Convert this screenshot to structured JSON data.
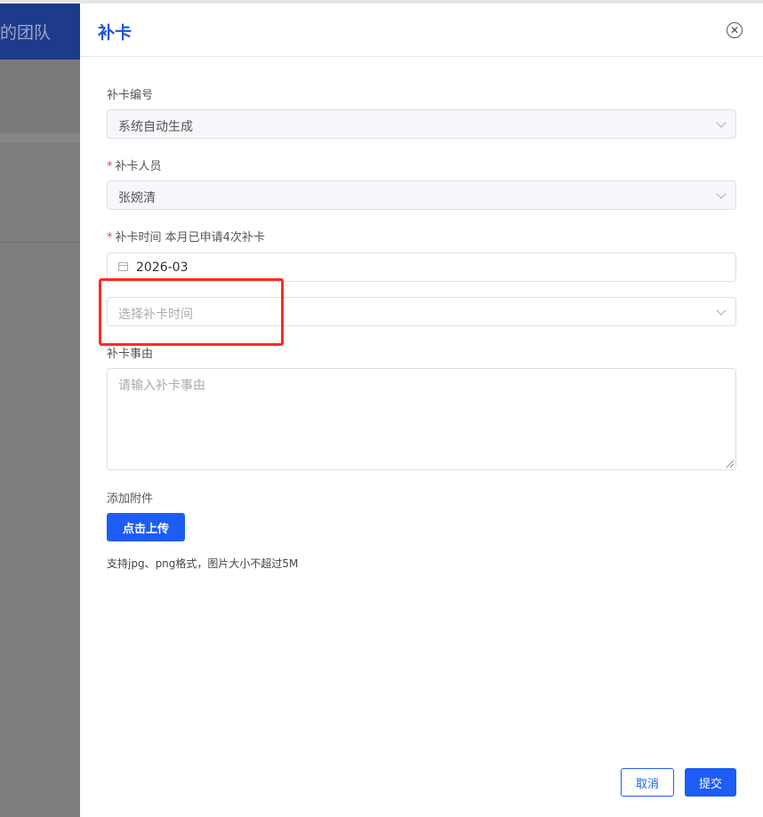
{
  "background": {
    "title": "的团队"
  },
  "drawer": {
    "title": "补卡",
    "close_icon": "close-circle-icon"
  },
  "form": {
    "id_label": "补卡编号",
    "id_value": "系统自动生成",
    "person_label": "补卡人员",
    "person_value": "张婉清",
    "time_label": "补卡时间 本月已申请4次补卡",
    "month_value": "2026-03",
    "time_placeholder": "选择补卡时间",
    "reason_label": "补卡事由",
    "reason_placeholder": "请输入补卡事由",
    "attachment_label": "添加附件",
    "upload_button": "点击上传",
    "upload_hint": "支持jpg、png格式，图片大小不超过5M",
    "required_mark": "*"
  },
  "footer": {
    "cancel_label": "取消",
    "submit_label": "提交"
  },
  "colors": {
    "primary": "#1d5cf5",
    "highlight": "#ff2a1f",
    "required": "#e53e3e"
  }
}
